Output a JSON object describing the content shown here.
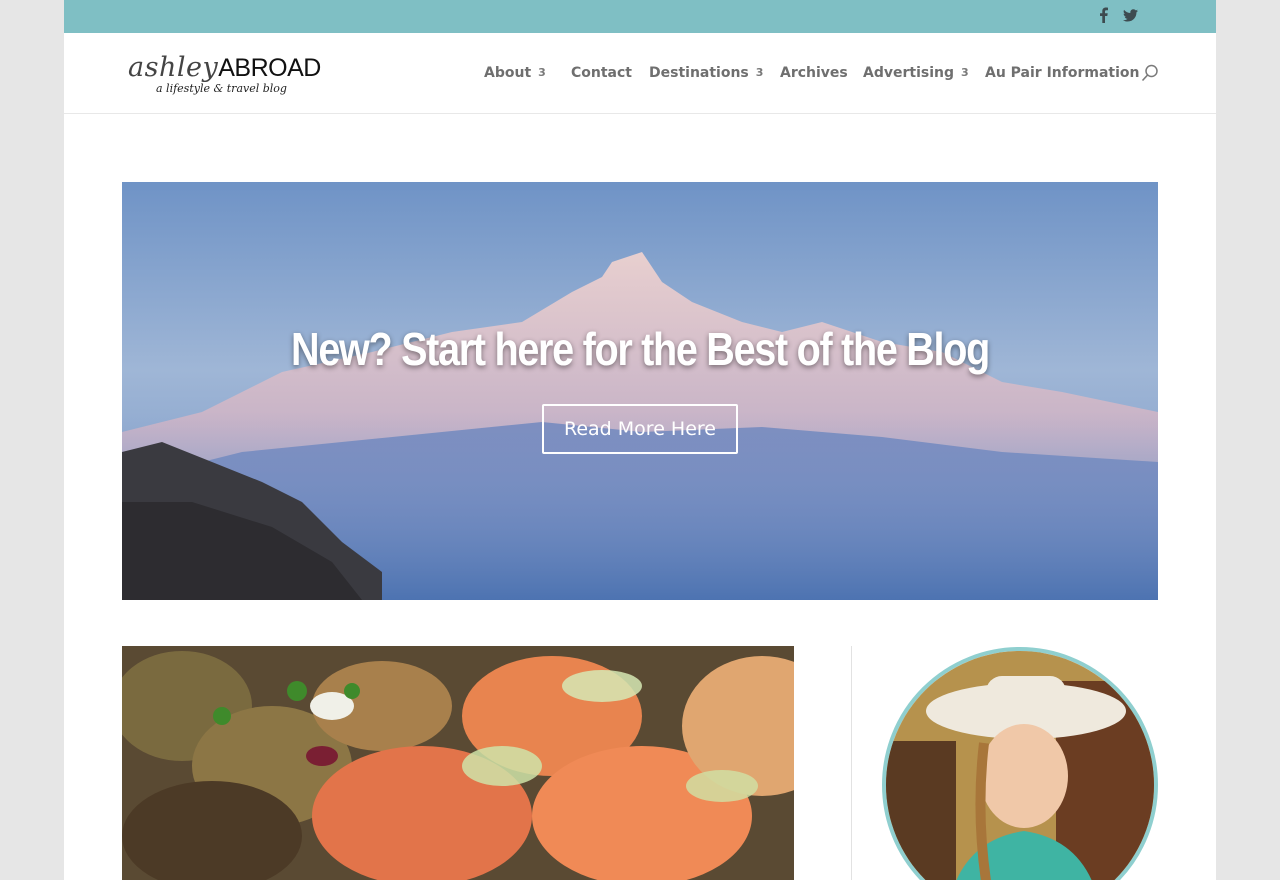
{
  "topbar": {
    "background": "#7fbfc4",
    "social_icons": [
      "facebook-icon",
      "twitter-icon"
    ]
  },
  "header": {
    "logo": {
      "script_text": "ashley",
      "caps_text": "ABROAD",
      "tagline": "a lifestyle & travel blog"
    },
    "nav": [
      {
        "label": "About",
        "has_dropdown": true,
        "dropdown_glyph": "3"
      },
      {
        "label": "Contact",
        "has_dropdown": false
      },
      {
        "label": "Destinations",
        "has_dropdown": true,
        "dropdown_glyph": "3"
      },
      {
        "label": "Archives",
        "has_dropdown": false
      },
      {
        "label": "Advertising",
        "has_dropdown": true,
        "dropdown_glyph": "3"
      },
      {
        "label": "Au Pair Information",
        "has_dropdown": false
      }
    ],
    "search_icon": "search-icon"
  },
  "hero": {
    "title": "New? Start here for the Best of the Blog",
    "button_label": "Read More Here",
    "image": "mountain-range-photo"
  },
  "content": {
    "post_image": "salmon-dish-photo",
    "sidebar_avatar": "author-cowgirl-photo",
    "avatar_border": "#8fcfcf"
  }
}
